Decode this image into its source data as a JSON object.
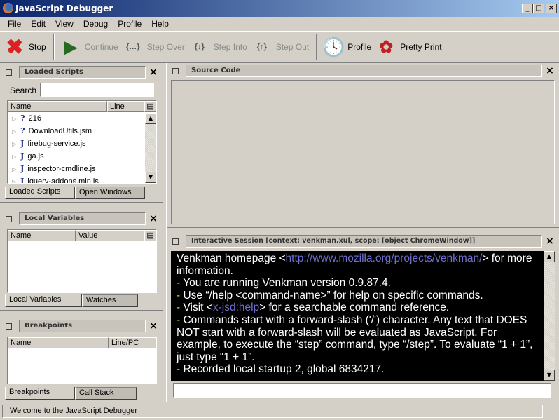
{
  "window": {
    "title": "JavaScript Debugger",
    "minimize": "_",
    "maximize": "□",
    "close": "×"
  },
  "menu": [
    "File",
    "Edit",
    "View",
    "Debug",
    "Profile",
    "Help"
  ],
  "toolbar": {
    "stop": "Stop",
    "continue": "Continue",
    "step_over": "Step Over",
    "step_into": "Step Into",
    "step_out": "Step Out",
    "profile": "Profile",
    "pretty_print": "Pretty Print"
  },
  "loaded_scripts": {
    "title": "Loaded Scripts",
    "search_label": "Search",
    "search_value": "",
    "columns": [
      "Name",
      "Line"
    ],
    "rows": [
      {
        "type": "?",
        "name": "216"
      },
      {
        "type": "?",
        "name": "DownloadUtils.jsm"
      },
      {
        "type": "J",
        "name": "firebug-service.js"
      },
      {
        "type": "J",
        "name": "ga.js"
      },
      {
        "type": "J",
        "name": "inspector-cmdline.js"
      },
      {
        "type": "J",
        "name": "jquery-addons.min.js"
      }
    ],
    "tabs": [
      "Loaded Scripts",
      "Open Windows"
    ]
  },
  "local_variables": {
    "title": "Local Variables",
    "columns": [
      "Name",
      "Value"
    ],
    "tabs": [
      "Local Variables",
      "Watches"
    ]
  },
  "breakpoints": {
    "title": "Breakpoints",
    "columns": [
      "Name",
      "Line/PC"
    ],
    "tabs": [
      "Breakpoints",
      "Call Stack"
    ]
  },
  "source_code": {
    "title": "Source Code"
  },
  "session": {
    "title": "Interactive Session [context: venkman.xul, scope: [object ChromeWindow]]",
    "line1_pre": "Venkman homepage <",
    "line1_link": "http://www.mozilla.org/projects/venkman/",
    "line1_post": "> for more information.",
    "line2": " You are running Venkman version 0.9.87.4.",
    "line3": " Use “/help <command-name>” for help on specific commands.",
    "line4_pre": " Visit <",
    "line4_link": "x-jsd:help",
    "line4_post": "> for a searchable command reference.",
    "line5": " Commands start with a forward-slash ('/') character.  Any text that DOES NOT start with a forward-slash will be evaluated as JavaScript.  For example, to execute the “step” command, type “/step”.  To evaluate “1 + 1”, just type “1 + 1”.",
    "line6": " Recorded local startup 2, global 6834217.",
    "dash": "-",
    "input_value": ""
  },
  "status": "Welcome to the JavaScript Debugger"
}
